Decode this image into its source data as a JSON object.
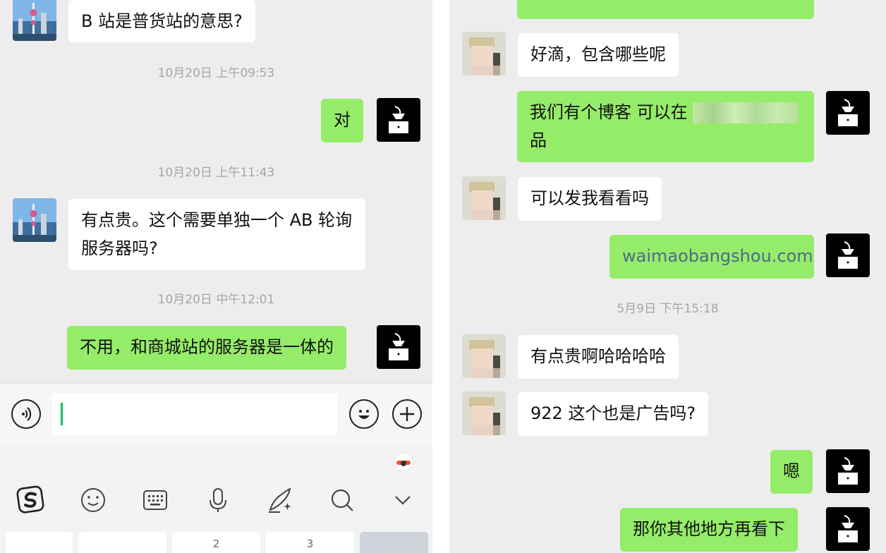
{
  "left_chat": {
    "messages": [
      {
        "text": "B 站是普货站的意思?"
      },
      {
        "text": "对"
      },
      {
        "text": "有点贵。这个需要单独一个 AB 轮询服务器吗?"
      },
      {
        "text": "不用，和商城站的服务器是一体的"
      }
    ],
    "timestamps": [
      "10月20日 上午09:53",
      "10月20日 上午11:43",
      "10月20日 中午12:01"
    ]
  },
  "input_bar": {
    "value": ""
  },
  "keyboard": {
    "key_labels": [
      "2",
      "3"
    ]
  },
  "right_chat": {
    "messages": [
      {
        "text": "好滴，包含哪些呢"
      },
      {
        "text": "我们有个博客 可以在"
      },
      {
        "text": "品"
      },
      {
        "text": "可以发我看看吗"
      },
      {
        "text": "waimaobangshou.com"
      },
      {
        "text": "有点贵啊哈哈哈哈"
      },
      {
        "text": "922 这个也是广告吗?"
      },
      {
        "text": "嗯"
      },
      {
        "text": "那你其他地方再看下"
      }
    ],
    "timestamps": [
      "5月9日 下午15:18"
    ]
  },
  "colors": {
    "outgoing_bubble": "#95ec69",
    "incoming_bubble": "#ffffff",
    "background": "#ededed",
    "caret": "#07c160"
  }
}
